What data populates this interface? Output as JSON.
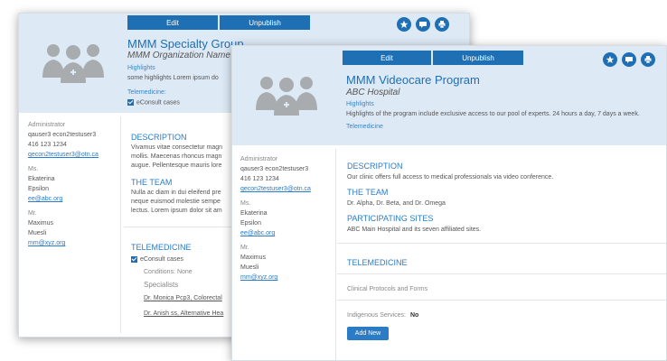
{
  "back": {
    "edit_label": "Edit",
    "unpublish_label": "Unpublish",
    "title": "MMM Specialty Group",
    "subtitle": "MMM Organization Name",
    "highlights_label": "Highlights",
    "highlights_text": "some highlights Lorem ipsum do",
    "telemedicine_label": "Telemedicine:",
    "econsult_label": "eConsult cases",
    "admin_role": "Administrator",
    "admin_name": "qauser3 econ2testuser3",
    "admin_phone": "416 123 1234",
    "admin_email": "qecon2testuser3@otn.ca",
    "contact1_role": "Ms.",
    "contact1_first": "Ekaterina",
    "contact1_last": "Epsilon",
    "contact1_email": "ee@abc.org",
    "contact2_role": "Mr.",
    "contact2_first": "Maximus",
    "contact2_last": "Muesli",
    "contact2_email": "mm@xyz.org",
    "description_head": "DESCRIPTION",
    "description_l1": "Vivamus vitae consectetur magn",
    "description_l2": "mollis. Maecenas rhoncus magn",
    "description_l3": "augue. Pellentesque mauris lore",
    "team_head": "THE TEAM",
    "team_l1": "Nulla ac diam in dui eleifend pre",
    "team_l2": "neque euismod molestie sempe",
    "team_l3": "lectus. Lorem ipsum dolor sit am",
    "telemedicine_head": "TELEMEDICINE",
    "econsult_label2": "eConsult cases",
    "conditions_label": "Conditions: None",
    "specialists_label": "Specialists",
    "specialist1": "Dr. Monica Pcp3, Colorectal",
    "specialist2": "Dr. Anish ss, Alternative Hea"
  },
  "front": {
    "edit_label": "Edit",
    "unpublish_label": "Unpublish",
    "title": "MMM Videocare Program",
    "subtitle": "ABC Hospital",
    "highlights_label": "Highlights",
    "highlights_text": "Highlights of the program include exclusive access to our pool of experts. 24 hours a day, 7 days a week.",
    "telemedicine_link": "Telemedicine",
    "admin_role": "Administrator",
    "admin_name": "qauser3 econ2testuser3",
    "admin_phone": "416 123 1234",
    "admin_email": "qecon2testuser3@otn.ca",
    "contact1_role": "Ms.",
    "contact1_first": "Ekaterina",
    "contact1_last": "Epsilon",
    "contact1_email": "ee@abc.org",
    "contact2_role": "Mr.",
    "contact2_first": "Maximus",
    "contact2_last": "Muesli",
    "contact2_email": "mm@xyz.org",
    "description_head": "DESCRIPTION",
    "description_text": "Our clinic offers full access to medical professionals via video conference.",
    "team_head": "THE TEAM",
    "team_text": "Dr. Alpha, Dr. Beta, and Dr. Omega",
    "sites_head": "PARTICIPATING SITES",
    "sites_text": "ABC Main Hospital and its seven affiliated sites.",
    "telemedicine_head": "TELEMEDICINE",
    "protocols_label": "Clinical Protocols and Forms",
    "indigenous_label": "Indigenous Services:",
    "indigenous_value": "No",
    "add_new_label": "Add New"
  },
  "colors": {
    "accent": "#1f6fb5",
    "link": "#2b7bc6",
    "header_bg": "#dde9f5"
  },
  "icons": [
    "people-group-icon",
    "star-icon",
    "chat-icon",
    "print-icon"
  ]
}
